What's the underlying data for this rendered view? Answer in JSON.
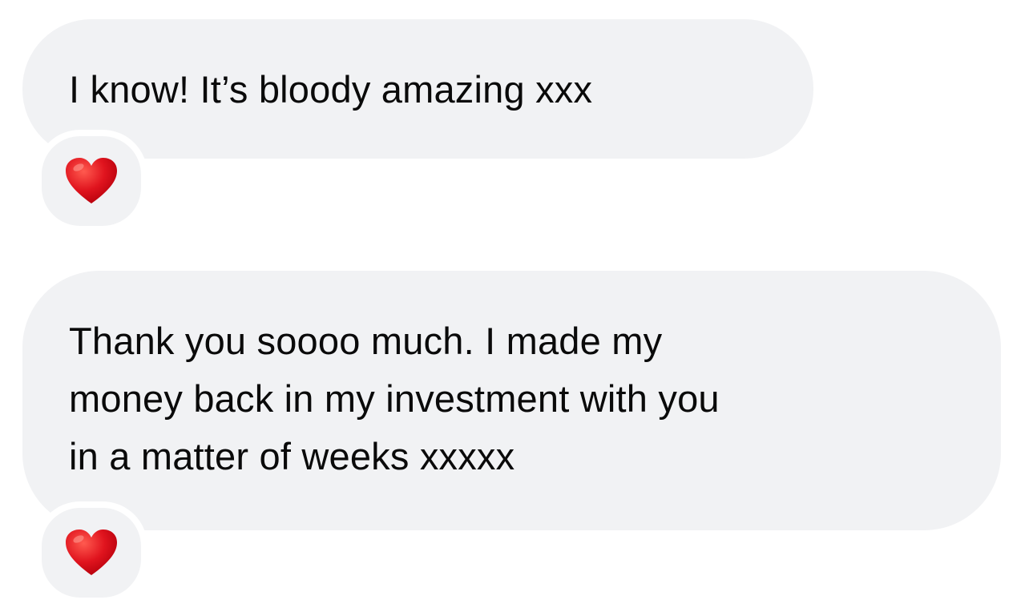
{
  "messages": [
    {
      "lines": [
        "I know! It’s bloody amazing xxx"
      ],
      "reaction": {
        "icon": "red-heart-icon",
        "color": "#e0141e"
      }
    },
    {
      "lines": [
        "Thank you soooo much. I made my",
        "money back in my investment with you",
        "in a matter of weeks xxxxx"
      ],
      "reaction": {
        "icon": "red-heart-icon",
        "color": "#e0141e"
      }
    }
  ],
  "colors": {
    "bubble_background": "#f1f2f4",
    "text": "#0a0a0a",
    "page_background": "#ffffff"
  }
}
